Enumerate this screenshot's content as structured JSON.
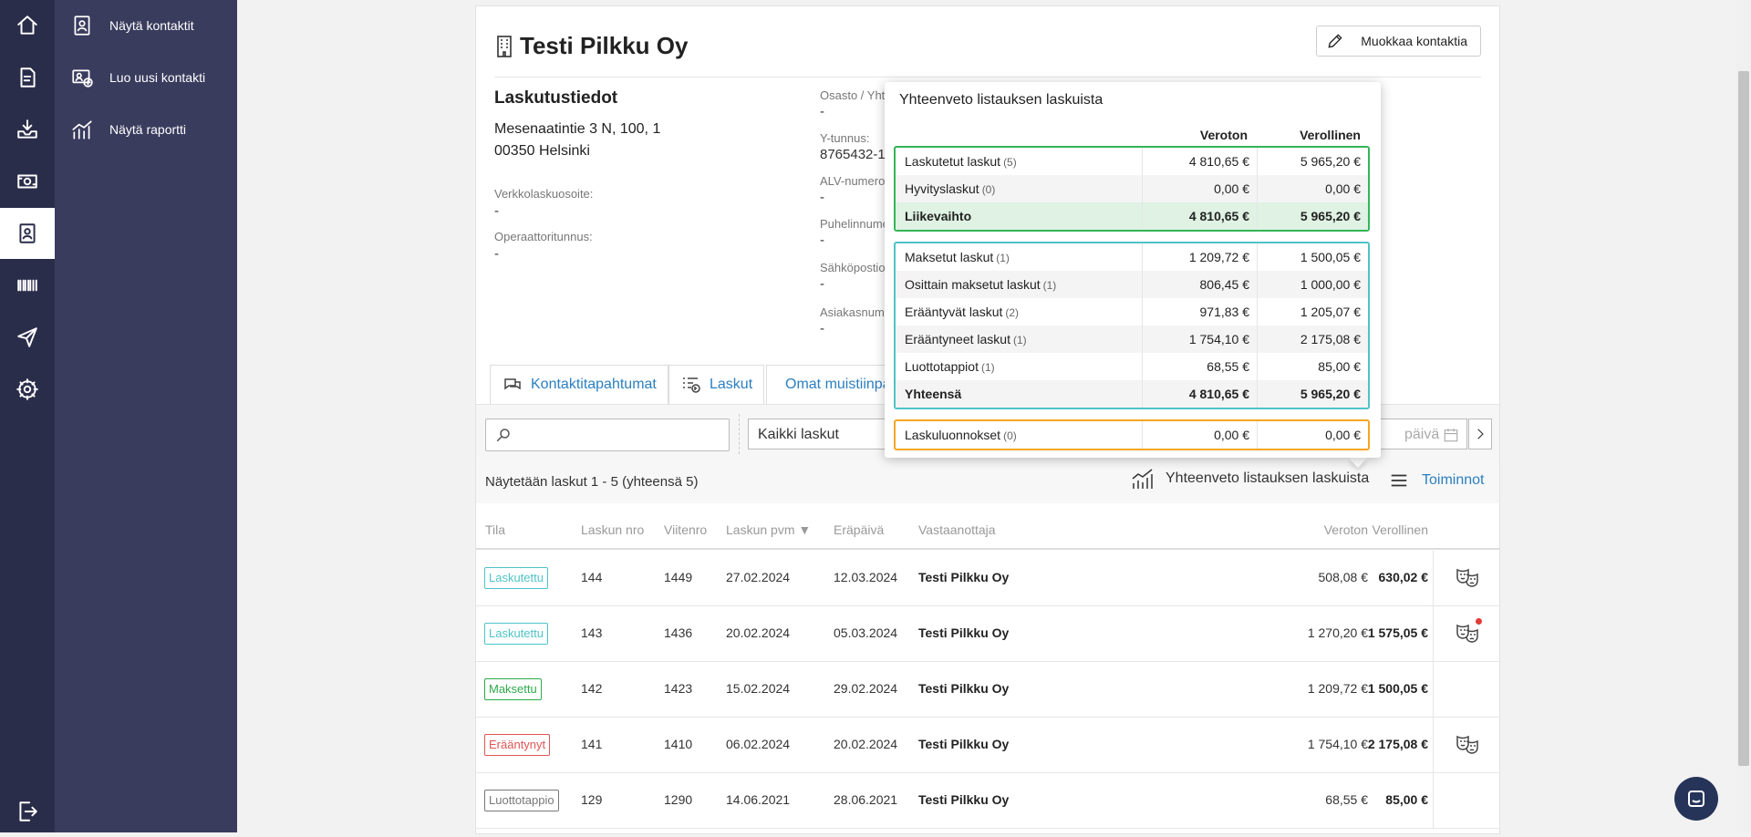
{
  "sidebar_nav": {
    "items": [
      {
        "icon": "home-icon"
      },
      {
        "icon": "invoice-icon"
      },
      {
        "icon": "inbox-icon"
      },
      {
        "icon": "money-icon"
      },
      {
        "icon": "contacts-icon",
        "active": true
      },
      {
        "icon": "barcode-icon"
      },
      {
        "icon": "send-icon"
      },
      {
        "icon": "settings-icon"
      }
    ],
    "logout_icon": "logout-icon"
  },
  "subnav": {
    "items": [
      {
        "label": "Näytä kontaktit",
        "icon": "contact-book-icon"
      },
      {
        "label": "Luo uusi kontakti",
        "icon": "add-contact-icon"
      },
      {
        "label": "Näytä raportti",
        "icon": "report-chart-icon"
      }
    ]
  },
  "contact": {
    "name": "Testi Pilkku Oy",
    "edit_label": "Muokkaa kontaktia",
    "billing_heading": "Laskutustiedot",
    "address_line1": "Mesenaatintie 3 N, 100, 1",
    "address_line2": "00350 Helsinki",
    "fields_left": [
      {
        "label": "Verkkolaskuosoite:",
        "value": "-"
      },
      {
        "label": "Operaattoritunnus:",
        "value": "-"
      }
    ],
    "fields_mid": [
      {
        "label": "Osasto / Yht",
        "value": "-"
      },
      {
        "label": "Y-tunnus:",
        "value": "8765432-1"
      },
      {
        "label": "ALV-numero",
        "value": "-"
      },
      {
        "label": "Puhelinnume",
        "value": "-"
      },
      {
        "label": "Sähköpostio",
        "value": "-"
      },
      {
        "label": "Asiakasnum",
        "value": "-"
      }
    ]
  },
  "tabs": [
    {
      "label": "Kontaktitapahtumat",
      "icon": "chat-bubbles-icon"
    },
    {
      "label": "Laskut",
      "icon": "invoice-list-icon"
    },
    {
      "label": "Omat muistiinpanot",
      "icon": "note-edit-icon"
    }
  ],
  "filters": {
    "search_value": "",
    "invoice_type": "Kaikki laskut",
    "date_placeholder": "päivä"
  },
  "list": {
    "count_text": "Näytetään laskut 1 - 5 (yhteensä 5)",
    "summary_link": "Yhteenveto listauksen laskuista",
    "actions_label": "Toiminnot",
    "columns": [
      "Tila",
      "Laskun nro",
      "Viitenro",
      "Laskun pvm ▼",
      "Eräpäivä",
      "Vastaanottaja",
      "Veroton",
      "Verollinen"
    ],
    "rows": [
      {
        "status": "Laskutettu",
        "status_color": "#4fc3c7",
        "nro": "144",
        "viite": "1449",
        "pvm": "27.02.2024",
        "erapaiva": "12.03.2024",
        "vastaanottaja": "Testi Pilkku Oy",
        "veroton": "508,08 €",
        "verollinen": "630,02 €",
        "action_icon": "masks-icon",
        "has_dot": false
      },
      {
        "status": "Laskutettu",
        "status_color": "#4fc3c7",
        "nro": "143",
        "viite": "1436",
        "pvm": "20.02.2024",
        "erapaiva": "05.03.2024",
        "vastaanottaja": "Testi Pilkku Oy",
        "veroton": "1 270,20 €",
        "verollinen": "1 575,05 €",
        "action_icon": "masks-icon",
        "has_dot": true
      },
      {
        "status": "Maksettu",
        "status_color": "#2eaa4a",
        "nro": "142",
        "viite": "1423",
        "pvm": "15.02.2024",
        "erapaiva": "29.02.2024",
        "vastaanottaja": "Testi Pilkku Oy",
        "veroton": "1 209,72 €",
        "verollinen": "1 500,05 €",
        "action_icon": "",
        "has_dot": false
      },
      {
        "status": "Erääntynyt",
        "status_color": "#e05555",
        "nro": "141",
        "viite": "1410",
        "pvm": "06.02.2024",
        "erapaiva": "20.02.2024",
        "vastaanottaja": "Testi Pilkku Oy",
        "veroton": "1 754,10 €",
        "verollinen": "2 175,08 €",
        "action_icon": "masks-icon",
        "has_dot": false
      },
      {
        "status": "Luottotappio",
        "status_color": "#777777",
        "nro": "129",
        "viite": "1290",
        "pvm": "14.06.2021",
        "erapaiva": "28.06.2021",
        "vastaanottaja": "Testi Pilkku Oy",
        "veroton": "68,55 €",
        "verollinen": "85,00 €",
        "action_icon": "",
        "has_dot": false
      }
    ]
  },
  "summary_popover": {
    "title": "Yhteenveto listauksen laskuista",
    "col_veroton": "Veroton",
    "col_verollinen": "Verollinen",
    "groups": [
      {
        "color": "#35b558",
        "rows": [
          {
            "label": "Laskutetut laskut",
            "count": "(5)",
            "veroton": "4 810,65 €",
            "verollinen": "5 965,20 €"
          },
          {
            "label": "Hyvityslaskut",
            "count": "(0)",
            "veroton": "0,00 €",
            "verollinen": "0,00 €"
          },
          {
            "label": "Liikevaihto",
            "count": "",
            "veroton": "4 810,65 €",
            "verollinen": "5 965,20 €",
            "bold": true,
            "green": true
          }
        ]
      },
      {
        "color": "#4fc3c7",
        "rows": [
          {
            "label": "Maksetut laskut",
            "count": "(1)",
            "veroton": "1 209,72 €",
            "verollinen": "1 500,05 €"
          },
          {
            "label": "Osittain maksetut laskut",
            "count": "(1)",
            "veroton": "806,45 €",
            "verollinen": "1 000,00 €"
          },
          {
            "label": "Erääntyvät laskut",
            "count": "(2)",
            "veroton": "971,83 €",
            "verollinen": "1 205,07 €"
          },
          {
            "label": "Erääntyneet laskut",
            "count": "(1)",
            "veroton": "1 754,10 €",
            "verollinen": "2 175,08 €"
          },
          {
            "label": "Luottotappiot",
            "count": "(1)",
            "veroton": "68,55 €",
            "verollinen": "85,00 €"
          },
          {
            "label": "Yhteensä",
            "count": "",
            "veroton": "4 810,65 €",
            "verollinen": "5 965,20 €",
            "bold": true
          }
        ]
      },
      {
        "color": "#f5a623",
        "rows": [
          {
            "label": "Laskuluonnokset",
            "count": "(0)",
            "veroton": "0,00 €",
            "verollinen": "0,00 €"
          }
        ]
      }
    ]
  },
  "chat_icon": "chat-icon"
}
